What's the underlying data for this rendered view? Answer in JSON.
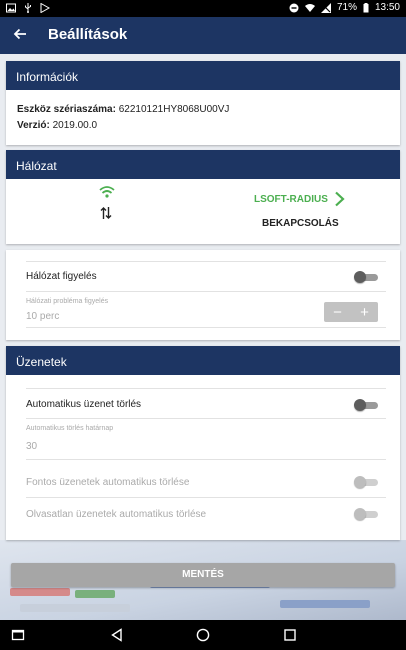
{
  "status_bar": {
    "battery": "71%",
    "time": "13:50",
    "icons_left": [
      "image-icon",
      "usb-icon",
      "play-store-icon"
    ],
    "icons_right": [
      "minus-circle-icon",
      "wifi-icon",
      "no-sim-icon",
      "battery-icon"
    ]
  },
  "app_bar": {
    "title": "Beállítások",
    "back_icon": "arrow-left-icon"
  },
  "info": {
    "title": "Információk",
    "serial_label": "Eszköz szériaszáma:",
    "serial_value": "62210121HY8068U00VJ",
    "version_label": "Verzió:",
    "version_value": "2019.00.0"
  },
  "network": {
    "title": "Hálózat",
    "ssid": "LSOFT-RADIUS",
    "connect_label": "BEKAPCSOLÁS",
    "accent": "#4caf50"
  },
  "monitoring": {
    "toggle_label": "Hálózat figyelés",
    "toggle_on": false,
    "interval_hint": "Hálózati probléma figyelés",
    "interval_value": "10 perc",
    "minus": "−",
    "plus": "+"
  },
  "messages": {
    "title": "Üzenetek",
    "auto_delete_label": "Automatikus üzenet törlés",
    "auto_delete_on": false,
    "limit_hint": "Automatikus törlés határnap",
    "limit_value": "30",
    "important_label": "Fontos üzenetek automatikus törlése",
    "unread_label": "Olvasatlan üzenetek automatikus törlése"
  },
  "save_button": "MENTÉS",
  "colors": {
    "header": "#1d3563",
    "accent_green": "#4caf50",
    "disabled": "#aaaaaa"
  },
  "nav_bar": {
    "icons": [
      "recents-square-icon",
      "back-triangle-icon",
      "home-circle-icon",
      "overview-square-icon"
    ]
  }
}
